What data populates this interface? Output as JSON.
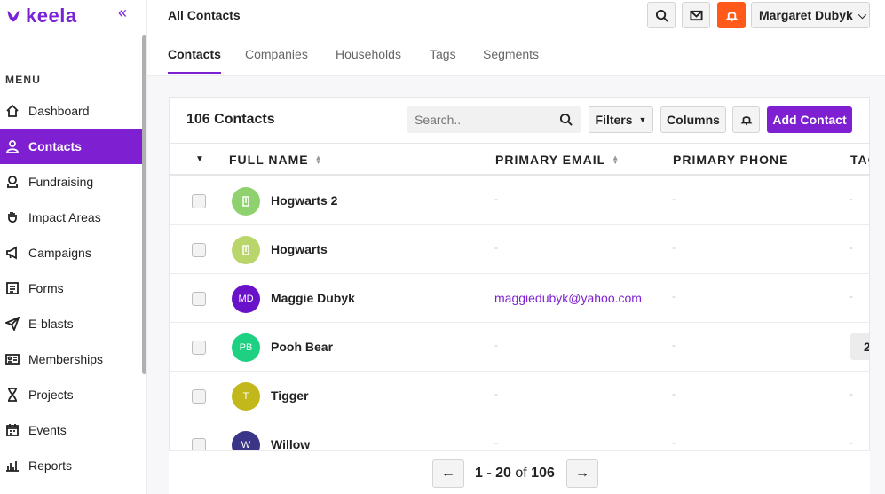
{
  "brand": {
    "name": "keela",
    "color": "#7a22d6"
  },
  "sidebar": {
    "collapse_label": "«",
    "menu_label": "MENU",
    "items": [
      {
        "label": "Dashboard",
        "icon": "home-icon",
        "active": false
      },
      {
        "label": "Contacts",
        "icon": "user-icon",
        "active": true
      },
      {
        "label": "Fundraising",
        "icon": "donation-icon",
        "active": false
      },
      {
        "label": "Impact Areas",
        "icon": "hand-icon",
        "active": false
      },
      {
        "label": "Campaigns",
        "icon": "megaphone-icon",
        "active": false
      },
      {
        "label": "Forms",
        "icon": "form-icon",
        "active": false
      },
      {
        "label": "E-blasts",
        "icon": "paper-plane-icon",
        "active": false
      },
      {
        "label": "Memberships",
        "icon": "id-card-icon",
        "active": false
      },
      {
        "label": "Projects",
        "icon": "hourglass-icon",
        "active": false
      },
      {
        "label": "Events",
        "icon": "calendar-icon",
        "active": false
      },
      {
        "label": "Reports",
        "icon": "bar-chart-icon",
        "active": false
      }
    ]
  },
  "header": {
    "title": "All Contacts",
    "user_name": "Margaret Dubyk",
    "alert_color": "#ff5a1a"
  },
  "tabs": [
    {
      "label": "Contacts",
      "active": true
    },
    {
      "label": "Companies",
      "active": false
    },
    {
      "label": "Households",
      "active": false
    },
    {
      "label": "Tags",
      "active": false
    },
    {
      "label": "Segments",
      "active": false
    }
  ],
  "toolbar": {
    "count_label": "106 Contacts",
    "search_placeholder": "Search..",
    "filters_label": "Filters",
    "columns_label": "Columns",
    "add_label": "Add Contact"
  },
  "table": {
    "columns": [
      "FULL NAME",
      "PRIMARY EMAIL",
      "PRIMARY PHONE",
      "TAG"
    ],
    "rows": [
      {
        "name": "Hogwarts 2",
        "initials": "",
        "avatar_color": "#8fd16e",
        "email": "-",
        "phone": "-",
        "tag": "-"
      },
      {
        "name": "Hogwarts",
        "initials": "",
        "avatar_color": "#b9d66a",
        "email": "-",
        "phone": "-",
        "tag": "-"
      },
      {
        "name": "Maggie Dubyk",
        "initials": "MD",
        "avatar_color": "#6a12c9",
        "email": "maggiedubyk@yahoo.com",
        "phone": "-",
        "tag": "-"
      },
      {
        "name": "Pooh Bear",
        "initials": "PB",
        "avatar_color": "#1ed081",
        "email": "-",
        "phone": "-",
        "tag": "2"
      },
      {
        "name": "Tigger",
        "initials": "T",
        "avatar_color": "#c2b81c",
        "email": "-",
        "phone": "-",
        "tag": "-"
      },
      {
        "name": "Willow",
        "initials": "W",
        "avatar_color": "#3a3586",
        "email": "-",
        "phone": "-",
        "tag": "-"
      }
    ]
  },
  "pagination": {
    "range": "1 - 20",
    "of": "of",
    "total": "106"
  }
}
